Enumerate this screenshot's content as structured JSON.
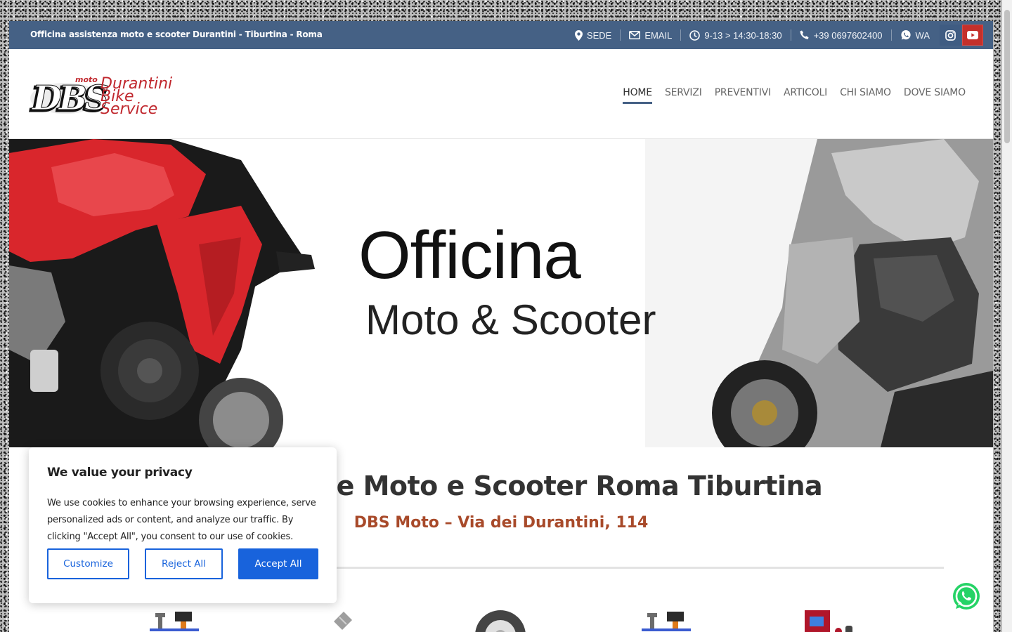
{
  "topbar": {
    "tagline": "Officina assistenza moto e scooter Durantini - Tiburtina - Roma",
    "sede": "SEDE",
    "email": "EMAIL",
    "hours": "9-13 > 14:30-18:30",
    "phone": "+39 0697602400",
    "wa": "WA"
  },
  "logo": {
    "letters": "DBS",
    "small": "moto",
    "line1": "Durantini",
    "line2": "Bike",
    "line3": "Service"
  },
  "nav": {
    "items": [
      "HOME",
      "SERVIZI",
      "PREVENTIVI",
      "ARTICOLI",
      "CHI SIAMO",
      "DOVE SIAMO"
    ],
    "active": "HOME"
  },
  "hero": {
    "title": "Officina",
    "subtitle": "Moto & Scooter"
  },
  "main": {
    "heading": "Riparazione Moto e Scooter Roma Tiburtina",
    "subheading": "DBS Moto – Via dei Durantini, 114"
  },
  "cookie": {
    "title": "We value your privacy",
    "text": "We use cookies to enhance your browsing experience, serve personalized ads or content, and analyze our traffic. By clicking \"Accept All\", you consent to our use of cookies.",
    "customize": "Customize",
    "reject": "Reject All",
    "accept": "Accept All"
  },
  "colors": {
    "topbar": "#456185",
    "accent_red": "#a84a2a",
    "cookie_blue": "#1863dc",
    "whatsapp": "#25d366",
    "youtube": "#c4302b"
  },
  "icons": [
    "map-pin-icon",
    "envelope-icon",
    "clock-icon",
    "phone-icon",
    "whatsapp-icon",
    "instagram-icon",
    "youtube-icon"
  ]
}
